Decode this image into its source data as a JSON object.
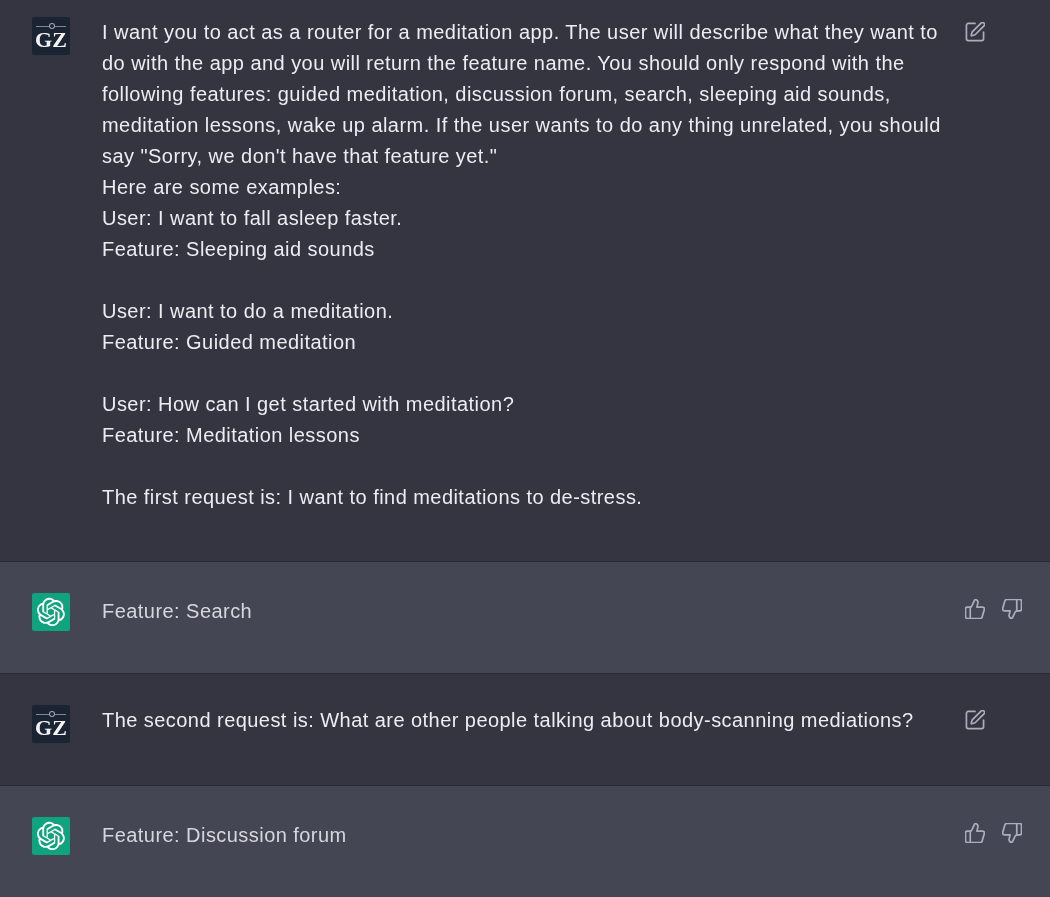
{
  "conversation": [
    {
      "kind": "user",
      "avatar": "GZ",
      "text": "I want you to act as a router for a meditation app. The user will describe what they want to do with the app and you will return the feature name. You should only respond with the following features: guided meditation, discussion forum, search, sleeping aid sounds, meditation lessons, wake up alarm. If the user wants to do any thing unrelated, you should say \"Sorry, we don't have that feature yet.\"\nHere are some examples:\nUser: I want to fall asleep faster.\nFeature: Sleeping aid sounds\n\nUser: I want to do a meditation.\nFeature: Guided meditation\n\nUser: How can I get started with meditation?\nFeature: Meditation lessons\n\nThe first request is: I want to find meditations to de-stress."
    },
    {
      "kind": "assistant",
      "text": "Feature: Search"
    },
    {
      "kind": "user",
      "avatar": "GZ",
      "text": "The second request is: What are other people talking about body-scanning mediations?"
    },
    {
      "kind": "assistant",
      "text": "Feature: Discussion forum"
    }
  ]
}
